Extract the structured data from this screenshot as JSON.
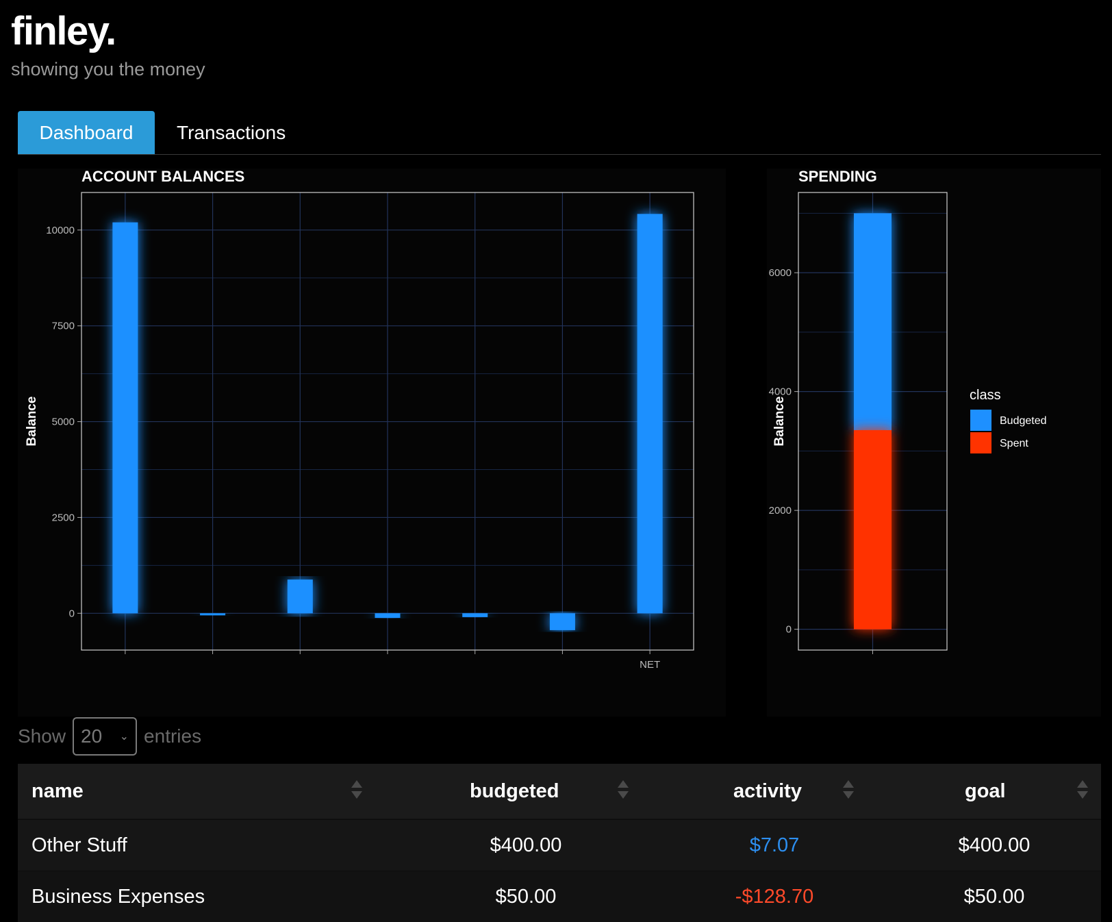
{
  "brand": {
    "title": "finley.",
    "subtitle": "showing you the money"
  },
  "tabs": [
    {
      "label": "Dashboard",
      "active": true
    },
    {
      "label": "Transactions",
      "active": false
    }
  ],
  "colors": {
    "budgeted": "#1e90ff",
    "spent": "#ff3300",
    "tab_active": "#2b9bd8"
  },
  "chart_data": [
    {
      "type": "bar",
      "title": "ACCOUNT BALANCES",
      "ylabel": "Balance",
      "categories": [
        "",
        "",
        "",
        "",
        "",
        "",
        "NET"
      ],
      "values": [
        10200,
        -20,
        880,
        -120,
        -100,
        -440,
        10420
      ],
      "yticks": [
        0,
        2500,
        5000,
        7500,
        10000
      ],
      "ylim": [
        -960,
        10980
      ],
      "grid": true,
      "color": "#1e90ff"
    },
    {
      "type": "bar",
      "title": "SPENDING",
      "ylabel": "Balance",
      "stacked": true,
      "categories": [
        ""
      ],
      "series": [
        {
          "name": "Budgeted",
          "values": [
            7000
          ],
          "color": "#1e90ff"
        },
        {
          "name": "Spent",
          "values": [
            3350
          ],
          "color": "#ff3300"
        }
      ],
      "yticks": [
        0,
        2000,
        4000,
        6000
      ],
      "ylim": [
        -350,
        7350
      ],
      "legend_title": "class",
      "legend_position": "right",
      "grid": true
    }
  ],
  "entries": {
    "show": "Show",
    "value": "20",
    "suffix": "entries"
  },
  "table": {
    "headers": [
      "name",
      "budgeted",
      "activity",
      "goal"
    ],
    "rows": [
      {
        "name": "Other Stuff",
        "budgeted": "$400.00",
        "activity": "$7.07",
        "activity_sign": "pos",
        "goal": "$400.00"
      },
      {
        "name": "Business Expenses",
        "budgeted": "$50.00",
        "activity": "-$128.70",
        "activity_sign": "neg",
        "goal": "$50.00"
      }
    ]
  }
}
